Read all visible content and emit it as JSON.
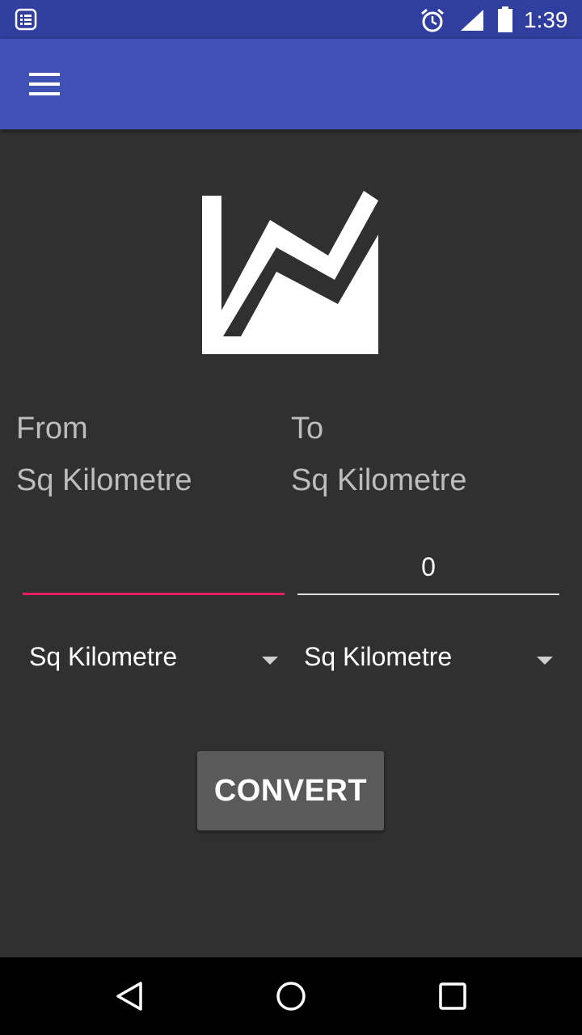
{
  "status_bar": {
    "time": "1:39",
    "icons": [
      "notification-list-icon",
      "alarm-icon",
      "signal-icon",
      "battery-icon"
    ]
  },
  "app_bar": {
    "menu_icon": "menu-icon"
  },
  "logo": {
    "icon": "area-chart-icon"
  },
  "from": {
    "title": "From",
    "unit_label": "Sq Kilometre",
    "input_value": "",
    "spinner_value": "Sq Kilometre"
  },
  "to": {
    "title": "To",
    "unit_label": "Sq Kilometre",
    "output_value": "0",
    "spinner_value": "Sq Kilometre"
  },
  "convert_label": "CONVERT",
  "nav_bar": {
    "icons": [
      "back-icon",
      "home-icon",
      "recents-icon"
    ]
  },
  "colors": {
    "status_bar": "#303f9f",
    "app_bar": "#3f51b5",
    "background": "#303030",
    "accent": "#e91e63",
    "button": "#5a5a5a"
  }
}
